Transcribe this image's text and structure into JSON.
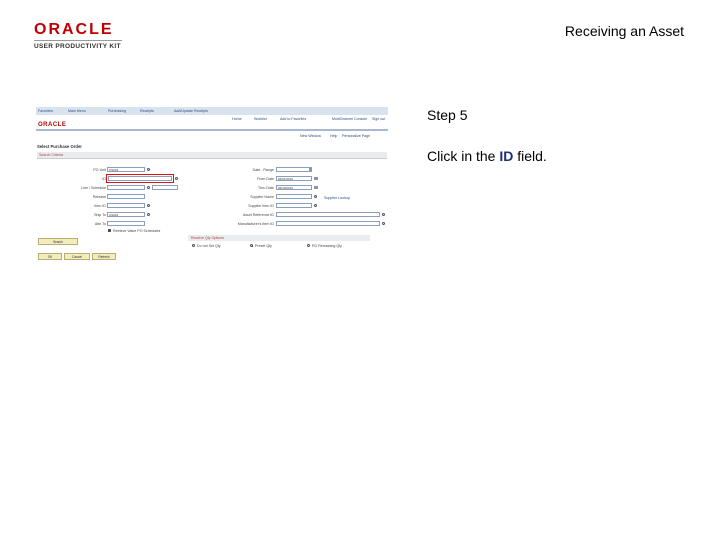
{
  "header": {
    "logo_oracle": "ORACLE",
    "logo_kit": "USER PRODUCTIVITY KIT",
    "title": "Receiving an Asset"
  },
  "step": {
    "label": "Step 5",
    "instruction_pre": "Click in the ",
    "instruction_bold": "ID",
    "instruction_post": " field."
  },
  "screenshot": {
    "nav": [
      "Favorites",
      "Main Menu",
      "Purchasing",
      "Receipts",
      "Add/Update Receipts"
    ],
    "header_links": [
      "Home",
      "Worklist",
      "Add to Favorites",
      "MultiChannel Console",
      "Sign out"
    ],
    "brand": "ORACLE",
    "sub_links": [
      "New Window",
      "Help",
      "Personalize Page"
    ],
    "page_title": "Select Purchase Order",
    "section_title": "Search Criteria",
    "left_fields": [
      {
        "label": "PO Unit",
        "value": "US001"
      },
      {
        "label": "ID",
        "value": ""
      },
      {
        "label": "Line / Schedule",
        "value": ""
      },
      {
        "label": "Release",
        "value": ""
      },
      {
        "label": "Item ID",
        "value": ""
      },
      {
        "label": "Ship To",
        "value": "US001"
      },
      {
        "label": "Attn To",
        "value": ""
      }
    ],
    "right_fields": [
      {
        "label": "Date - Range",
        "value": ""
      },
      {
        "label": "From Date",
        "value": "06/01/2010"
      },
      {
        "label": "Thru Date",
        "value": "06/30/2010"
      },
      {
        "label": "Supplier Name",
        "value": ""
      },
      {
        "label": "Supplier Item ID",
        "value": ""
      },
      {
        "label": "Asset Reference ID",
        "value": ""
      },
      {
        "label": "Manufacturer's Item ID",
        "value": ""
      }
    ],
    "supplier_lookup": "Supplier Lookup",
    "retrieve_label": "Retrieve Value PO Schedules",
    "search_button": "Search",
    "group_title": "Receive Qty Options",
    "radios": [
      "Do not Set Qty",
      "Preset Qty",
      "PO Remaining Qty"
    ],
    "bottom_buttons": [
      "OK",
      "Cancel",
      "Refresh"
    ]
  }
}
